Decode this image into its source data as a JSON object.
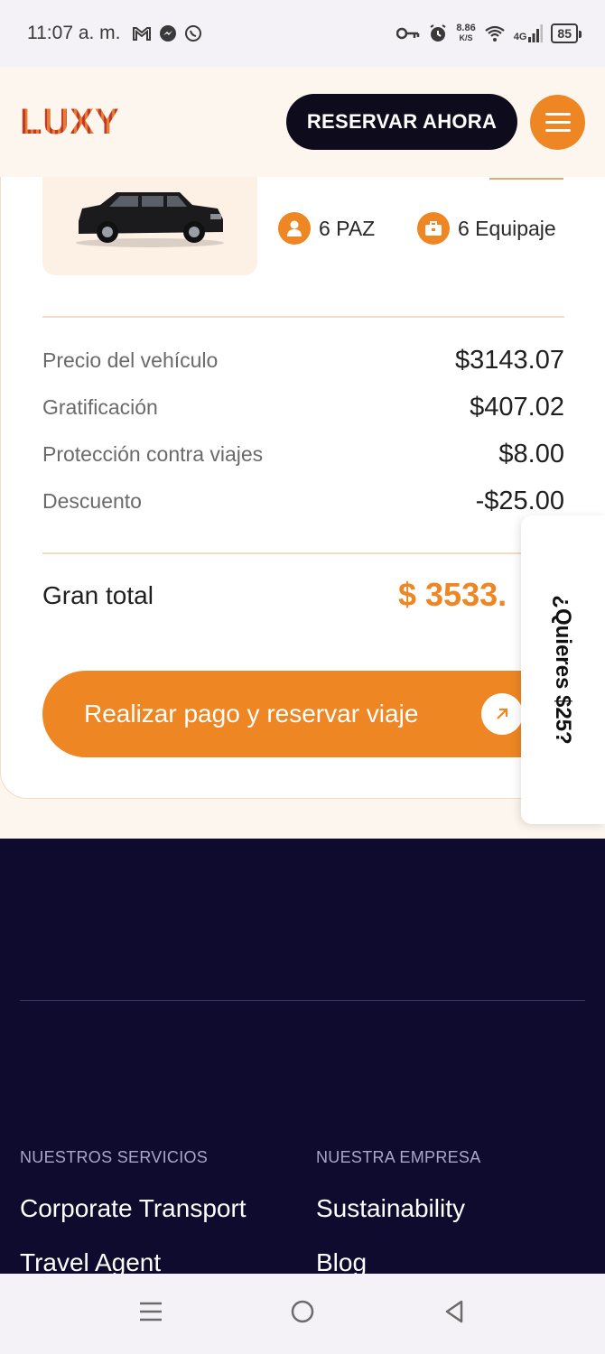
{
  "status_bar": {
    "time": "11:07 a. m.",
    "net_speed_value": "8.86",
    "net_speed_unit": "K/S",
    "network": "4G",
    "battery": "85"
  },
  "header": {
    "logo": "LUXY",
    "reserve_label": "RESERVAR AHORA"
  },
  "vehicle": {
    "passengers": "6 PAZ",
    "luggage": "6 Equipaje"
  },
  "prices": [
    {
      "label": "Precio del vehículo",
      "value": "$3143.07"
    },
    {
      "label": "Gratificación",
      "value": "$407.02"
    },
    {
      "label": "Protección contra viajes",
      "value": "$8.00"
    },
    {
      "label": "Descuento",
      "value": "-$25.00"
    }
  ],
  "total": {
    "label": "Gran total",
    "value": "$ 3533."
  },
  "pay_button": "Realizar pago y reservar viaje",
  "side_tab": "¿Quieres $25?",
  "footer": {
    "services_heading": "NUESTROS SERVICIOS",
    "services_links": [
      "Corporate Transport",
      "Travel Agent"
    ],
    "company_heading": "NUESTRA EMPRESA",
    "company_links": [
      "Sustainability",
      "Blog"
    ]
  },
  "colors": {
    "accent": "#ee8623",
    "dark": "#0d0b1c",
    "footer_bg": "#0e0b2e"
  },
  "icons": [
    "gmail-icon",
    "messenger-icon",
    "whatsapp-icon",
    "key-icon",
    "alarm-icon",
    "wifi-icon",
    "signal-icon",
    "person-icon",
    "briefcase-icon",
    "arrow-up-right-icon",
    "menu-icon"
  ]
}
